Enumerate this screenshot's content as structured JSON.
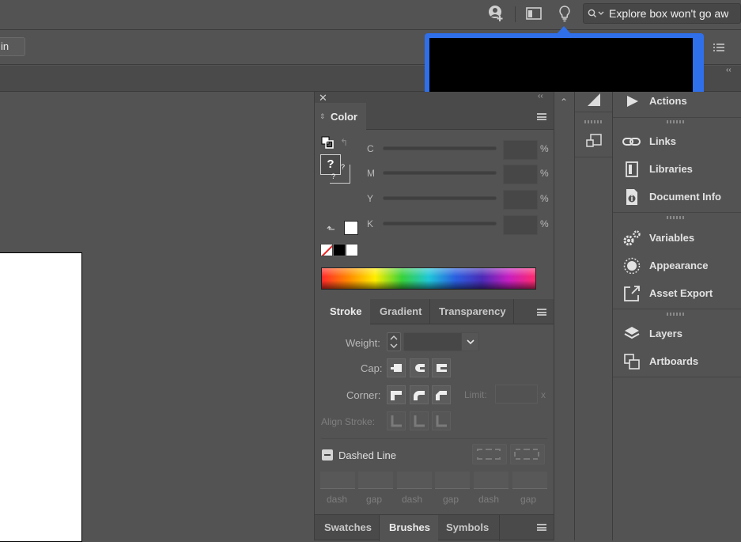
{
  "topbar": {
    "search_placeholder": "Explore box won't go aw",
    "icons": [
      "user-plus-icon",
      "window-layout-icon",
      "lightbulb-icon",
      "search-icon"
    ]
  },
  "controlbar": {
    "left_button": "in"
  },
  "color_panel": {
    "tab": "Color",
    "channels": [
      {
        "label": "C",
        "unit": "%"
      },
      {
        "label": "M",
        "unit": "%"
      },
      {
        "label": "Y",
        "unit": "%"
      },
      {
        "label": "K",
        "unit": "%"
      }
    ],
    "unknown_mark": "?"
  },
  "stroke_panel": {
    "tabs": [
      "Stroke",
      "Gradient",
      "Transparency"
    ],
    "weight_label": "Weight:",
    "cap_label": "Cap:",
    "corner_label": "Corner:",
    "limit_label": "Limit:",
    "limit_unit": "x",
    "align_label": "Align Stroke:",
    "dashed_label": "Dashed Line",
    "dash_labels": [
      "dash",
      "gap",
      "dash",
      "gap",
      "dash",
      "gap"
    ]
  },
  "bottom_tabs": [
    "Swatches",
    "Brushes",
    "Symbols"
  ],
  "right_panel": {
    "groups": [
      [
        "Actions"
      ],
      [
        "Links",
        "Libraries",
        "Document Info"
      ],
      [
        "Variables",
        "Appearance",
        "Asset Export"
      ],
      [
        "Layers",
        "Artboards"
      ]
    ]
  },
  "colors": {
    "highlight": "#2f6fea",
    "redacted": "#000000",
    "bg": "#535353"
  }
}
